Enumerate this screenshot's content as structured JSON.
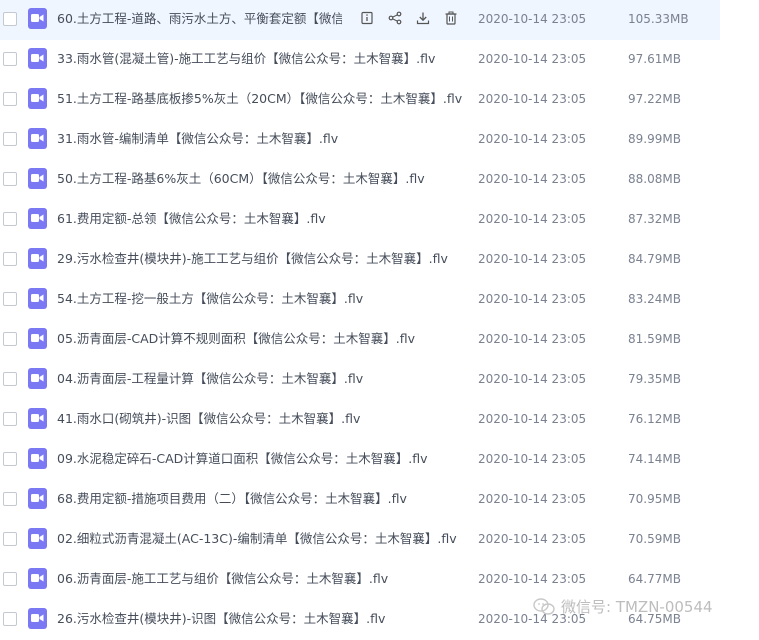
{
  "files": [
    {
      "name": "60.土方工程-道路、雨污水土方、平衡套定额【微信...",
      "date": "2020-10-14 23:05",
      "size": "105.33MB"
    },
    {
      "name": "33.雨水管(混凝土管)-施工工艺与组价【微信公众号：土木智襄】.flv",
      "date": "2020-10-14 23:05",
      "size": "97.61MB"
    },
    {
      "name": "51.土方工程-路基底板掺5%灰土（20CM）【微信公众号：土木智襄】.flv",
      "date": "2020-10-14 23:05",
      "size": "97.22MB"
    },
    {
      "name": "31.雨水管-编制清单【微信公众号：土木智襄】.flv",
      "date": "2020-10-14 23:05",
      "size": "89.99MB"
    },
    {
      "name": "50.土方工程-路基6%灰土（60CM）【微信公众号：土木智襄】.flv",
      "date": "2020-10-14 23:05",
      "size": "88.08MB"
    },
    {
      "name": "61.费用定额-总领【微信公众号：土木智襄】.flv",
      "date": "2020-10-14 23:05",
      "size": "87.32MB"
    },
    {
      "name": "29.污水检查井(模块井)-施工工艺与组价【微信公众号：土木智襄】.flv",
      "date": "2020-10-14 23:05",
      "size": "84.79MB"
    },
    {
      "name": "54.土方工程-挖一般土方【微信公众号：土木智襄】.flv",
      "date": "2020-10-14 23:05",
      "size": "83.24MB"
    },
    {
      "name": "05.沥青面层-CAD计算不规则面积【微信公众号：土木智襄】.flv",
      "date": "2020-10-14 23:05",
      "size": "81.59MB"
    },
    {
      "name": "04.沥青面层-工程量计算【微信公众号：土木智襄】.flv",
      "date": "2020-10-14 23:05",
      "size": "79.35MB"
    },
    {
      "name": "41.雨水口(砌筑井)-识图【微信公众号：土木智襄】.flv",
      "date": "2020-10-14 23:05",
      "size": "76.12MB"
    },
    {
      "name": "09.水泥稳定碎石-CAD计算道口面积【微信公众号：土木智襄】.flv",
      "date": "2020-10-14 23:05",
      "size": "74.14MB"
    },
    {
      "name": "68.费用定额-措施项目费用（二）【微信公众号：土木智襄】.flv",
      "date": "2020-10-14 23:05",
      "size": "70.95MB"
    },
    {
      "name": "02.细粒式沥青混凝土(AC-13C)-编制清单【微信公众号：土木智襄】.flv",
      "date": "2020-10-14 23:05",
      "size": "70.59MB"
    },
    {
      "name": "06.沥青面层-施工工艺与组价【微信公众号：土木智襄】.flv",
      "date": "2020-10-14 23:05",
      "size": "64.77MB"
    },
    {
      "name": "26.污水检查井(模块井)-识图【微信公众号：土木智襄】.flv",
      "date": "2020-10-14 23:05",
      "size": "64.75MB"
    }
  ],
  "row_actions": [
    "info-icon",
    "share-icon",
    "download-icon",
    "delete-icon"
  ],
  "watermark": {
    "text": "微信号: TMZN-00544"
  },
  "colors": {
    "video_icon": "#7b78f3",
    "hover_row": "#f0f6ff",
    "text": "#454d5a"
  }
}
